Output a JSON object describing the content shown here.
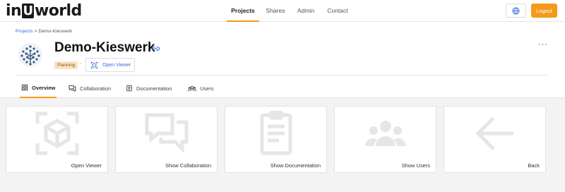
{
  "app": {
    "logo_left": "in",
    "logo_u": "U",
    "logo_right": "world"
  },
  "nav": {
    "items": [
      {
        "label": "Projects",
        "active": true
      },
      {
        "label": "Shares",
        "active": false
      },
      {
        "label": "Admin",
        "active": false
      },
      {
        "label": "Contact",
        "active": false
      }
    ],
    "globe_icon": "globe-icon",
    "logout_label": "Logout"
  },
  "breadcrumb": {
    "parent": "Projects",
    "separator": ">",
    "current": "Demo-Kieswerk"
  },
  "project": {
    "title": "Demo-Kieswerk",
    "status": "Planning",
    "separator": "-",
    "open_viewer_label": "Open Viewer",
    "more_label": "···"
  },
  "tabs": [
    {
      "label": "Overview",
      "icon": "grid-icon",
      "active": true
    },
    {
      "label": "Collaboration",
      "icon": "chat-icon",
      "active": false
    },
    {
      "label": "Documentation",
      "icon": "document-icon",
      "active": false
    },
    {
      "label": "Users",
      "icon": "users-icon",
      "active": false
    }
  ],
  "cards": [
    {
      "label": "Open Viewer",
      "icon": "cube-viewer-icon"
    },
    {
      "label": "Show Collaboration",
      "icon": "chat-bubbles-icon"
    },
    {
      "label": "Show Documentation",
      "icon": "clipboard-icon"
    },
    {
      "label": "Show Users",
      "icon": "users-icon"
    },
    {
      "label": "Back",
      "icon": "arrow-left-icon"
    }
  ],
  "colors": {
    "accent": "#f49a1a",
    "link": "#3b6fd8",
    "card_icon": "#e6e6e6",
    "status_bg": "#fbe3c4"
  }
}
